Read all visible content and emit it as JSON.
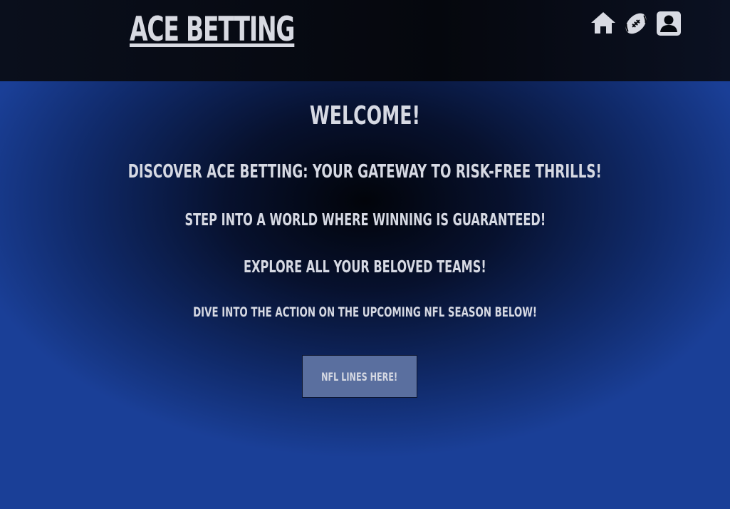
{
  "header": {
    "brand": "ACE BETTING",
    "icons": [
      "home-icon",
      "football-icon",
      "account-icon"
    ]
  },
  "main": {
    "welcome": "WELCOME!",
    "discover": "DISCOVER ACE BETTING: YOUR GATEWAY TO RISK-FREE THRILLS!",
    "step": "STEP INTO A WORLD WHERE WINNING IS GUARANTEED!",
    "explore": "EXPLORE ALL YOUR BELOVED TEAMS!",
    "dive": "DIVE INTO THE ACTION ON THE UPCOMING NFL SEASON BELOW!",
    "cta_label": "NFL LINES HERE!"
  },
  "colors": {
    "header_bg": "#05070d",
    "text": "#d8dae2",
    "button_bg": "#5a6f9f",
    "gradient_edge": "#1a3f97"
  }
}
